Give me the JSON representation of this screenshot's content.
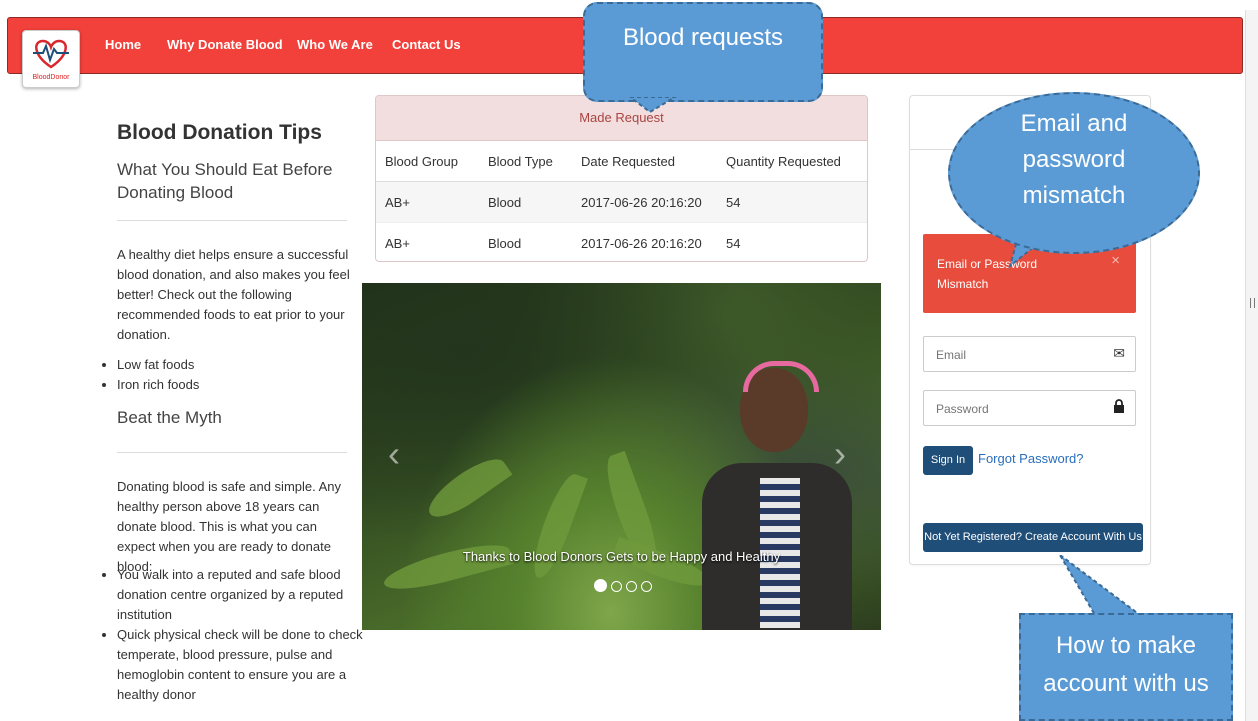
{
  "logo": {
    "text": "BloodDonor"
  },
  "nav": {
    "items": [
      "Home",
      "Why Donate Blood",
      "Who We Are",
      "Contact Us"
    ]
  },
  "tips": {
    "title": "Blood Donation Tips",
    "subtitle": "What You Should Eat Before Donating Blood",
    "intro": "A healthy diet helps ensure a successful blood donation, and also makes you feel better! Check out the following recommended foods to eat prior to your donation.",
    "foods": [
      "Low fat foods",
      "Iron rich foods"
    ],
    "myth_title": "Beat the Myth",
    "myth_intro": "Donating blood is safe and simple. Any healthy person above 18 years can donate blood. This is what you can expect when you are ready to donate blood:",
    "myth_points": [
      "You walk into a reputed and safe blood donation centre organized by a reputed institution",
      "Quick physical check will be done to check temperate, blood pressure, pulse and hemoglobin content to ensure you are a healthy donor"
    ]
  },
  "requests": {
    "heading": "Made Request",
    "columns": [
      "Blood Group",
      "Blood Type",
      "Date Requested",
      "Quantity Requested"
    ],
    "rows": [
      [
        "AB+",
        "Blood",
        "2017-06-26 20:16:20",
        "54"
      ],
      [
        "AB+",
        "Blood",
        "2017-06-26 20:16:20",
        "54"
      ]
    ]
  },
  "carousel": {
    "caption": "Thanks to Blood Donors Gets to be Happy and Healthy",
    "slide_count": 4,
    "active_index": 0
  },
  "login": {
    "alert_text": "Email or Password Mismatch",
    "alert_close": "×",
    "email_placeholder": "Email",
    "password_placeholder": "Password",
    "signin_label": "Sign In",
    "forgot_label": "Forgot Password?",
    "register_label": "Not Yet Registered? Create Account With Us"
  },
  "callouts": {
    "requests": "Blood requests",
    "mismatch": "Email and password mismatch",
    "account": "How to make account with us"
  },
  "colors": {
    "navbar": "#f2403a",
    "alert": "#e74c3c",
    "button": "#1f4e79",
    "callout": "#5b9bd5"
  }
}
